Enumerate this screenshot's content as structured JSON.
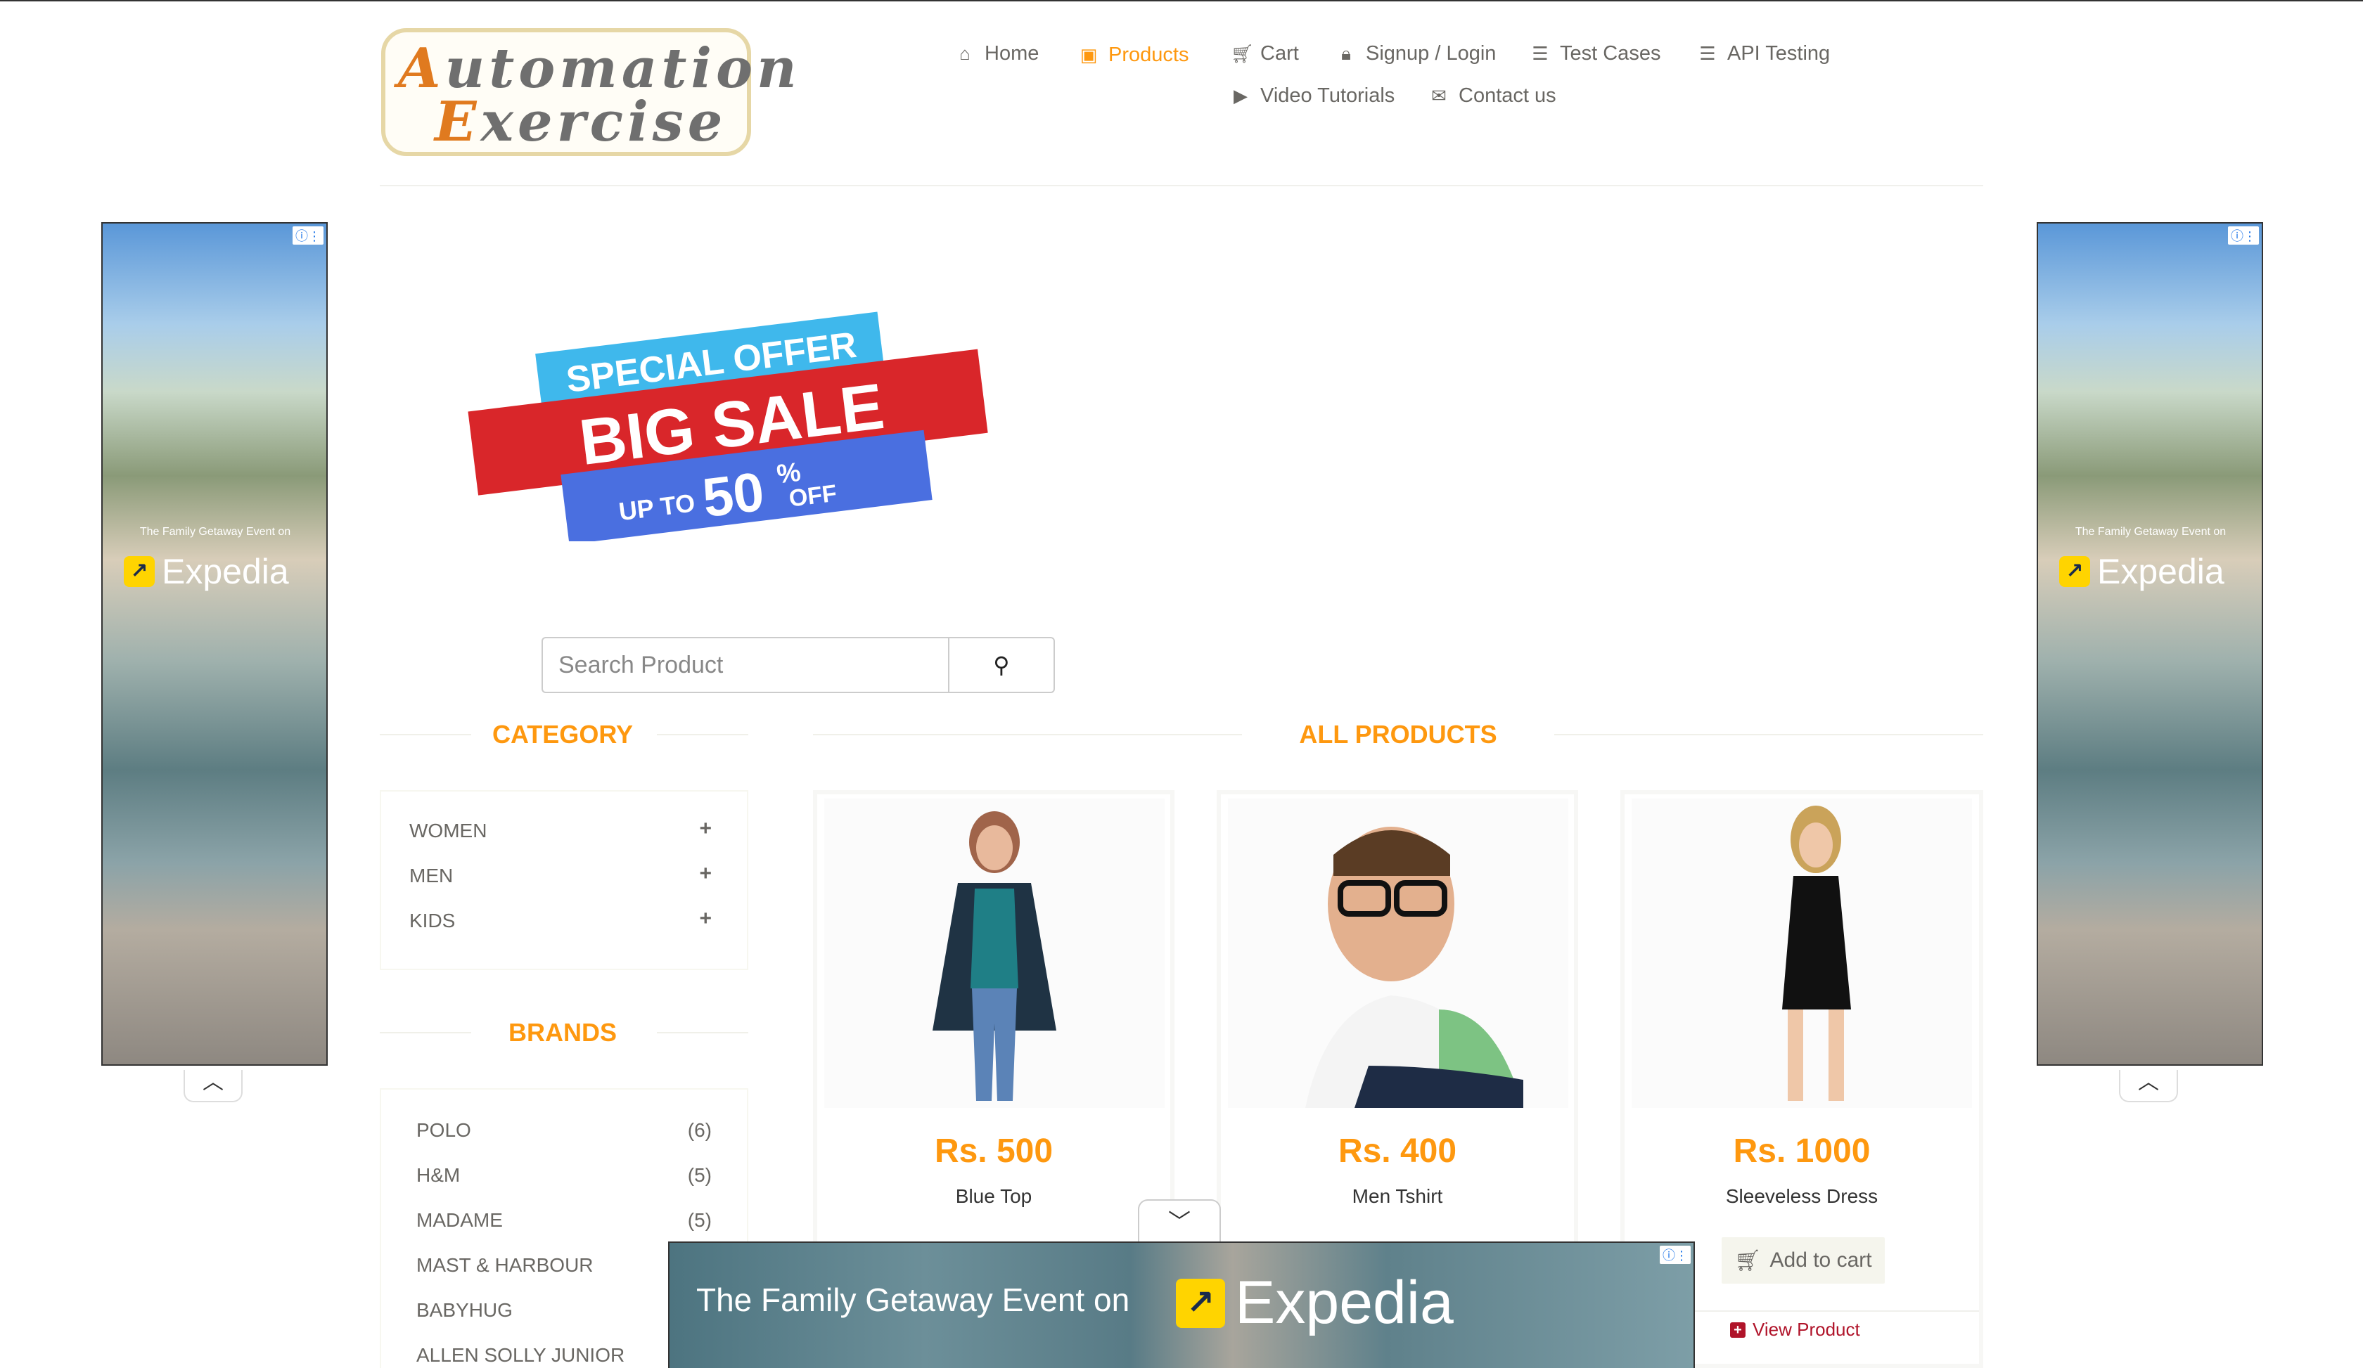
{
  "logo": {
    "line1": "Automation",
    "line2": "Exercise"
  },
  "nav": {
    "home": "Home",
    "products": "Products",
    "cart": "Cart",
    "signup": "Signup / Login",
    "test_cases": "Test Cases",
    "api_testing": "API Testing",
    "video_tutorials": "Video Tutorials",
    "contact_us": "Contact us"
  },
  "ads": {
    "side_caption": "The Family Getaway Event on",
    "side_brand": "Expedia",
    "bottom_text": "The Family Getaway Event on",
    "bottom_brand": "Expedia"
  },
  "banner": {
    "line1": "SPECIAL OFFER",
    "line2": "BIG SALE",
    "up_to": "UP TO",
    "percent": "50",
    "pct_sign": "%",
    "off": "OFF"
  },
  "search": {
    "placeholder": "Search Product"
  },
  "category": {
    "title": "CATEGORY",
    "items": [
      {
        "label": "WOMEN"
      },
      {
        "label": "MEN"
      },
      {
        "label": "KIDS"
      }
    ]
  },
  "brands": {
    "title": "BRANDS",
    "items": [
      {
        "label": "POLO",
        "count": "(6)"
      },
      {
        "label": "H&M",
        "count": "(5)"
      },
      {
        "label": "MADAME",
        "count": "(5)"
      },
      {
        "label": "MAST & HARBOUR",
        "count": ""
      },
      {
        "label": "BABYHUG",
        "count": ""
      },
      {
        "label": "ALLEN SOLLY JUNIOR",
        "count": ""
      }
    ]
  },
  "products": {
    "title": "ALL PRODUCTS",
    "items": [
      {
        "price": "Rs. 500",
        "name": "Blue Top"
      },
      {
        "price": "Rs. 400",
        "name": "Men Tshirt"
      },
      {
        "price": "Rs. 1000",
        "name": "Sleeveless Dress",
        "add_to_cart": "Add to cart",
        "view_product": "View Product"
      }
    ]
  },
  "colors": {
    "accent": "#fe980f",
    "text": "#696763",
    "view_link": "#b0142a"
  }
}
